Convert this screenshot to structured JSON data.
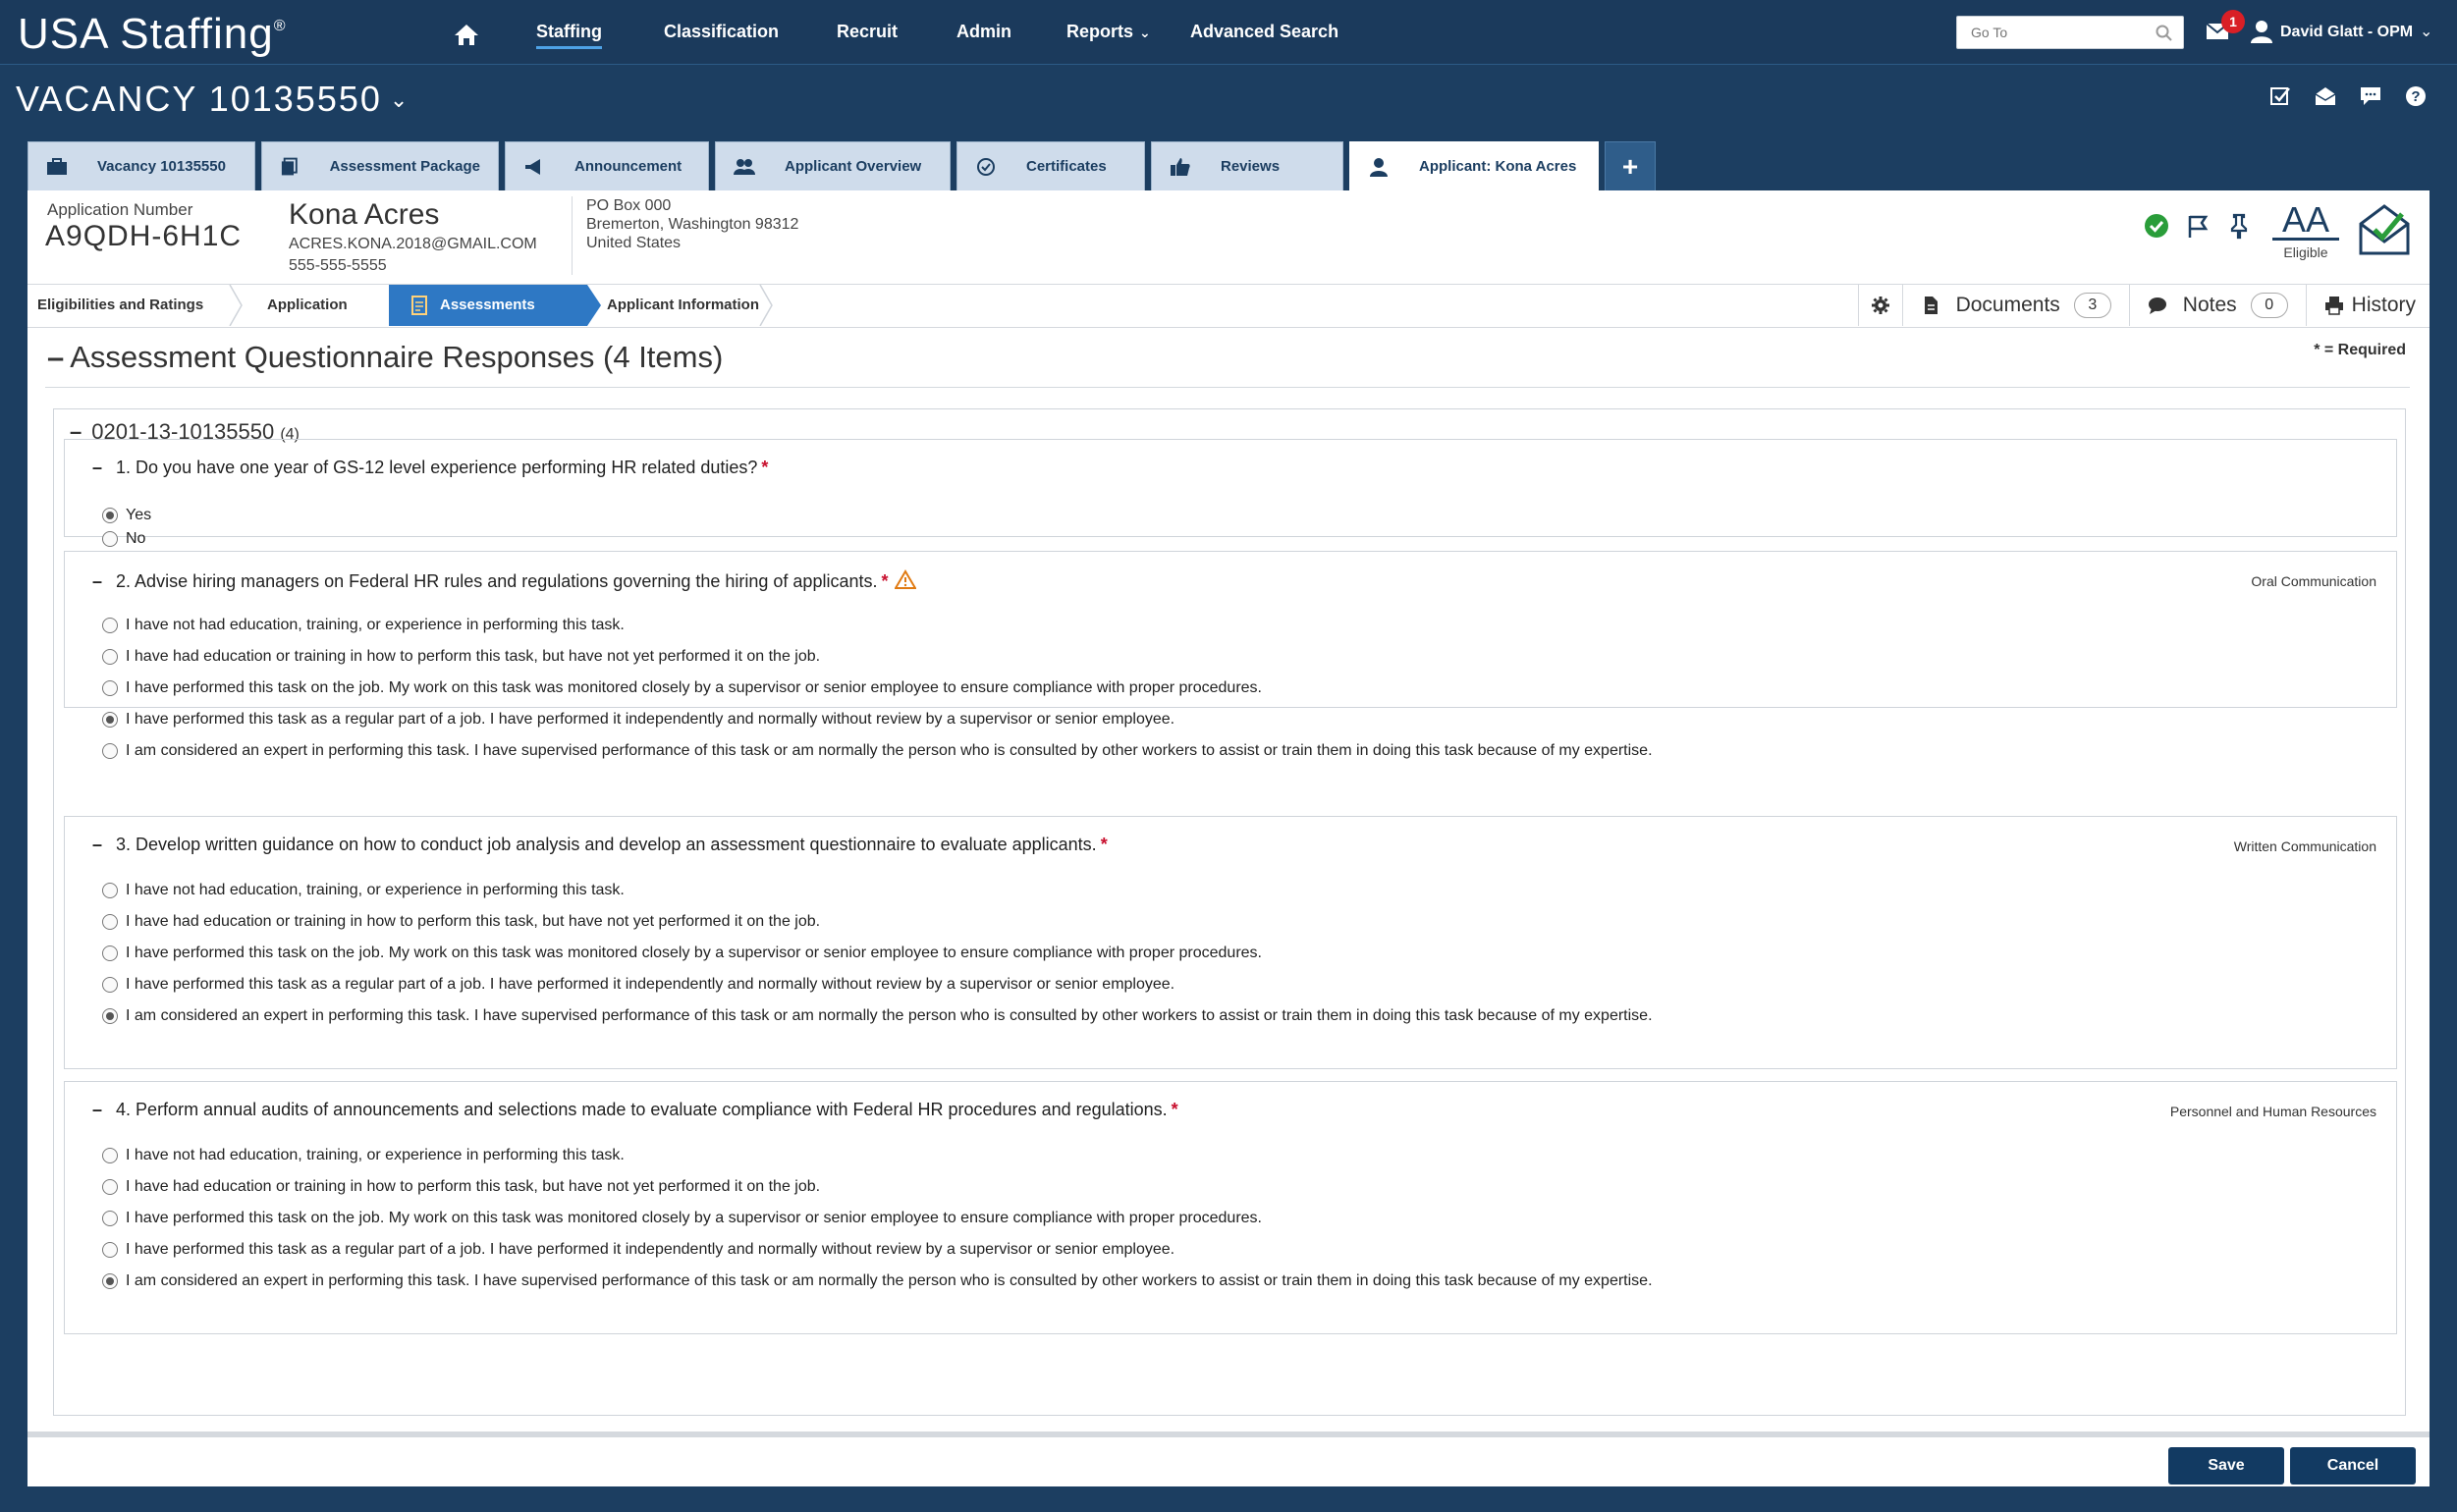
{
  "topnav": {
    "logo": "USA Staffing",
    "logo_mark": "®",
    "items": [
      {
        "label": "Staffing",
        "active": true
      },
      {
        "label": "Classification"
      },
      {
        "label": "Recruit"
      },
      {
        "label": "Admin"
      },
      {
        "label": "Reports"
      },
      {
        "label": "Advanced Search"
      }
    ],
    "goto_placeholder": "Go To",
    "notification_count": "1",
    "user_name": "David Glatt - OPM"
  },
  "vacancy": {
    "title": "VACANCY 10135550"
  },
  "tabs": [
    {
      "label": "Vacancy 10135550"
    },
    {
      "label": "Assessment Package"
    },
    {
      "label": "Announcement"
    },
    {
      "label": "Applicant Overview"
    },
    {
      "label": "Certificates"
    },
    {
      "label": "Reviews"
    },
    {
      "label": "Applicant: Kona Acres",
      "active": true
    }
  ],
  "applicant": {
    "number_label": "Application Number",
    "number": "A9QDH-6H1C",
    "name": "Kona Acres",
    "email": "ACRES.KONA.2018@GMAIL.COM",
    "phone": "555-555-5555",
    "address": [
      "PO Box 000",
      "Bremerton, Washington 98312",
      "United States"
    ],
    "badge_letters": "AA",
    "badge_label": "Eligible"
  },
  "crumbs": [
    {
      "label": "Eligibilities and Ratings"
    },
    {
      "label": "Application"
    },
    {
      "label": "Assessments",
      "active": true
    },
    {
      "label": "Applicant Information"
    }
  ],
  "tools": {
    "documents_label": "Documents",
    "documents_count": "3",
    "notes_label": "Notes",
    "notes_count": "0",
    "history_label": "History"
  },
  "questionnaire": {
    "title": "Assessment Questionnaire Responses (4 Items)",
    "required_note": "* = Required",
    "group_title": "0201-13-10135550",
    "group_count": "(4)",
    "questions": [
      {
        "number": "1.",
        "text": "Do you have one year of GS-12 level experience performing HR related duties?",
        "category": "",
        "options": [
          "Yes",
          "No"
        ],
        "selected": 0
      },
      {
        "number": "2.",
        "text": "Advise hiring managers on Federal HR rules and regulations governing the hiring of applicants.",
        "category": "Oral Communication",
        "options": [
          "I have not had education, training, or experience in performing this task.",
          "I have had education or training in how to perform this task, but have not yet performed it on the job.",
          "I have performed this task on the job. My work on this task was monitored closely by a supervisor or senior employee to ensure compliance with proper procedures.",
          "I have performed this task as a regular part of a job. I have performed it independently and normally without review by a supervisor or senior employee.",
          "I am considered an expert in performing this task. I have supervised performance of this task or am normally the person who is consulted by other workers to assist or train them in doing this task because of my expertise."
        ],
        "selected": 3
      },
      {
        "number": "3.",
        "text": "Develop written guidance on how to conduct job analysis and develop an assessment questionnaire to evaluate applicants.",
        "category": "Written Communication",
        "options": [
          "I have not had education, training, or experience in performing this task.",
          "I have had education or training in how to perform this task, but have not yet performed it on the job.",
          "I have performed this task on the job. My work on this task was monitored closely by a supervisor or senior employee to ensure compliance with proper procedures.",
          "I have performed this task as a regular part of a job. I have performed it independently and normally without review by a supervisor or senior employee.",
          "I am considered an expert in performing this task. I have supervised performance of this task or am normally the person who is consulted by other workers to assist or train them in doing this task because of my expertise."
        ],
        "selected": 4
      },
      {
        "number": "4.",
        "text": "Perform annual audits of announcements and selections made to evaluate compliance with Federal HR procedures and regulations.",
        "category": "Personnel and Human Resources",
        "options": [
          "I have not had education, training, or experience in performing this task.",
          "I have had education or training in how to perform this task, but have not yet performed it on the job.",
          "I have performed this task on the job. My work on this task was monitored closely by a supervisor or senior employee to ensure compliance with proper procedures.",
          "I have performed this task as a regular part of a job. I have performed it independently and normally without review by a supervisor or senior employee.",
          "I am considered an expert in performing this task. I have supervised performance of this task or am normally the person who is consulted by other workers to assist or train them in doing this task because of my expertise."
        ],
        "selected": 4
      }
    ]
  },
  "footer": {
    "save_label": "Save",
    "cancel_label": "Cancel"
  },
  "colors": {
    "nav_bg": "#1b3a5c",
    "accent": "#2e78c4",
    "button": "#123a62",
    "required": "#c8102e"
  }
}
